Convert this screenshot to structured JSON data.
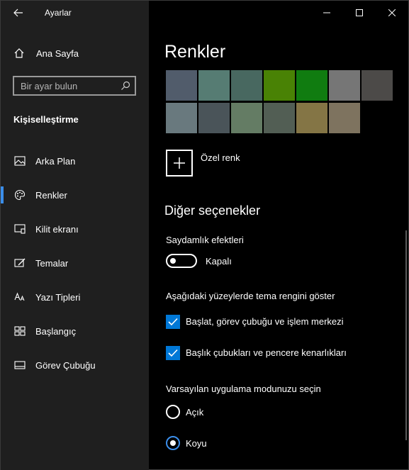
{
  "window": {
    "title": "Ayarlar",
    "controls": [
      "minimize",
      "maximize",
      "close"
    ]
  },
  "sidebar": {
    "home_label": "Ana Sayfa",
    "search_placeholder": "Bir ayar bulun",
    "section_title": "Kişiselleştirme",
    "items": [
      {
        "label": "Arka Plan",
        "icon": "picture-icon",
        "active": false
      },
      {
        "label": "Renkler",
        "icon": "palette-icon",
        "active": true
      },
      {
        "label": "Kilit ekranı",
        "icon": "lock-screen-icon",
        "active": false
      },
      {
        "label": "Temalar",
        "icon": "themes-icon",
        "active": false
      },
      {
        "label": "Yazı Tipleri",
        "icon": "fonts-icon",
        "active": false
      },
      {
        "label": "Başlangıç",
        "icon": "start-icon",
        "active": false
      },
      {
        "label": "Görev Çubuğu",
        "icon": "taskbar-icon",
        "active": false
      }
    ]
  },
  "main": {
    "title": "Renkler",
    "swatches_row1": [
      "#515c6b",
      "#567c73",
      "#486860",
      "#498205",
      "#107c10",
      "#767676",
      "#4c4a48"
    ],
    "swatches_row2": [
      "#69797e",
      "#4a5459",
      "#647c64",
      "#525e54",
      "#847545",
      "#7e735f"
    ],
    "custom_color_label": "Özel renk",
    "other_options_title": "Diğer seçenekler",
    "transparency": {
      "label": "Saydamlık efektleri",
      "state_label": "Kapalı",
      "on": false
    },
    "accent_surfaces": {
      "label": "Aşağıdaki yüzeylerde tema rengini göster",
      "start_taskbar_label": "Başlat, görev çubuğu ve işlem merkezi",
      "start_taskbar_checked": true,
      "titlebars_label": "Başlık çubukları ve pencere kenarlıkları",
      "titlebars_checked": true
    },
    "app_mode": {
      "label": "Varsayılan uygulama modunuzu seçin",
      "options": [
        "Açık",
        "Koyu"
      ],
      "selected": "Koyu"
    }
  },
  "colors": {
    "accent": "#0078d7",
    "sidebar_bg": "#1f1f1f",
    "main_bg": "#000000"
  }
}
